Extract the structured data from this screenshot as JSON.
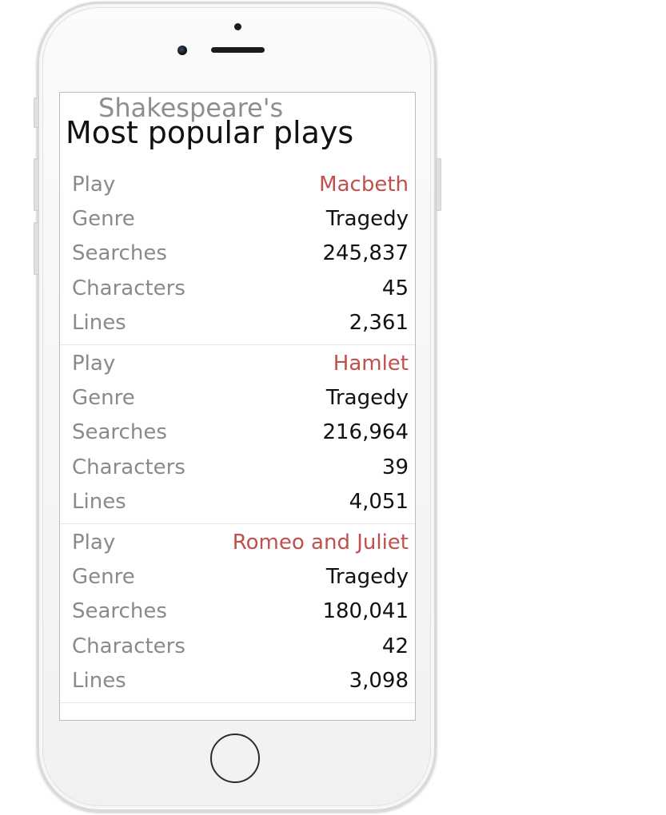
{
  "header": {
    "subtitle": "Shakespeare's",
    "title": "Most popular plays"
  },
  "labels": {
    "play": "Play",
    "genre": "Genre",
    "searches": "Searches",
    "characters": "Characters",
    "lines": "Lines"
  },
  "plays": [
    {
      "play": "Macbeth",
      "genre": "Tragedy",
      "searches": "245,837",
      "characters": "45",
      "lines": "2,361"
    },
    {
      "play": "Hamlet",
      "genre": "Tragedy",
      "searches": "216,964",
      "characters": "39",
      "lines": "4,051"
    },
    {
      "play": "Romeo and Juliet",
      "genre": "Tragedy",
      "searches": "180,041",
      "characters": "42",
      "lines": "3,098"
    }
  ],
  "colors": {
    "accent": "#c0504d",
    "label": "#8a8a8a",
    "value": "#111111"
  },
  "icons": {
    "home": "home-button-circle",
    "camera": "front-camera-icon",
    "speaker": "earpiece-speaker-icon"
  }
}
